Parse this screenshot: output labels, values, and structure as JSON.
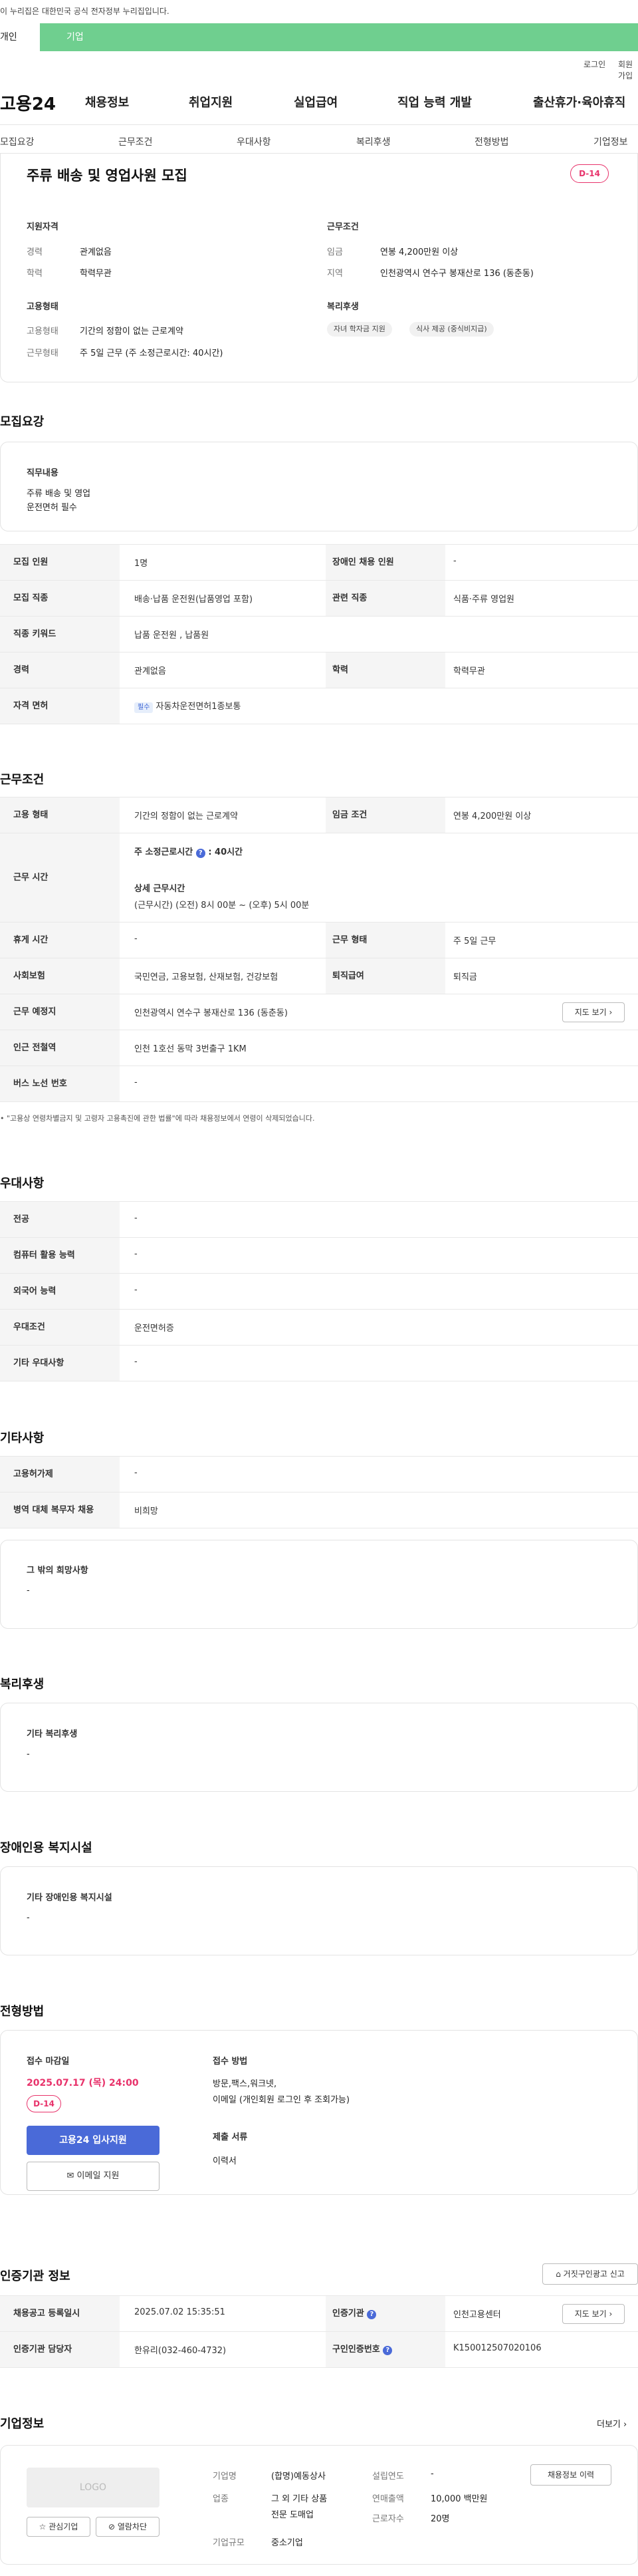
{
  "gov_banner": "이 누리집은 대한민국 공식 전자정부 누리집입니다.",
  "top_tabs": {
    "individual": "개인",
    "company": "기업"
  },
  "util": {
    "login": "로그인",
    "join": "회원가입"
  },
  "logo": "고용24",
  "gnav": [
    "채용정보",
    "취업지원",
    "실업급여",
    "직업 능력 개발",
    "출산휴가·육아휴직"
  ],
  "subnav": [
    "모집요강",
    "근무조건",
    "우대사항",
    "복리후생",
    "전형방법",
    "기업정보"
  ],
  "summary": {
    "title": "주류 배송 및 영업사원 모집",
    "dday": "D-14",
    "qual_label": "지원자격",
    "career_k": "경력",
    "career_v": "관계없음",
    "edu_k": "학력",
    "edu_v": "학력무관",
    "cond_label": "근무조건",
    "wage_k": "임금",
    "wage_v": "연봉 4,200만원 이상",
    "area_k": "지역",
    "area_v": "인천광역시 연수구 봉재산로 136 (동춘동)",
    "emp_label": "고용형태",
    "emp_k": "고용형태",
    "emp_v": "기간의 정함이 없는 근로계약",
    "work_k": "근무형태",
    "work_v": "주 5일 근무 (주 소정근로시간: 40시간)",
    "welfare_label": "복리후생",
    "chips": [
      "자녀 학자금 지원",
      "식사 제공 (중식비지급)"
    ]
  },
  "recruit": {
    "heading": "모집요강",
    "duty_label": "직무내용",
    "duty_lines": [
      "주류 배송 및 영업",
      "운전면허 필수"
    ],
    "rows": {
      "count_k": "모집 인원",
      "count_v": "1명",
      "disabled_k": "장애인 채용 인원",
      "disabled_v": "-",
      "job_k": "모집 직종",
      "job_v": "배송·납품 운전원(납품영업 포함)",
      "rel_k": "관련 직종",
      "rel_v": "식품·주류 영업원",
      "kw_k": "직종 키워드",
      "kw_v": "납품 운전원 , 납품원",
      "career_k": "경력",
      "career_v": "관계없음",
      "edu_k": "학력",
      "edu_v": "학력무관",
      "lic_k": "자격 면허",
      "lic_badge": "필수",
      "lic_v": "자동차운전면허1종보통"
    }
  },
  "work": {
    "heading": "근무조건",
    "emp_k": "고용 형태",
    "emp_v": "기간의 정함이 없는 근로계약",
    "wage_k": "임금 조건",
    "wage_v": "연봉 4,200만원 이상",
    "time_k": "근무 시간",
    "time_week_label": "주 소정근로시간",
    "time_week_v": ": 40시간",
    "time_detail_label": "상세 근무시간",
    "time_detail_v": "(근무시간) (오전) 8시 00분 ~ (오후) 5시 00분",
    "rest_k": "휴게 시간",
    "rest_v": "-",
    "form_k": "근무 형태",
    "form_v": "주 5일 근무",
    "ins_k": "사회보험",
    "ins_v": "국민연금, 고용보험, 산재보험, 건강보험",
    "ret_k": "퇴직급여",
    "ret_v": "퇴직금",
    "place_k": "근무 예정지",
    "place_v": "인천광역시 연수구 봉재산로 136 (동춘동)",
    "map_btn": "지도 보기",
    "station_k": "인근 전철역",
    "station_v": "인천 1호선 동막 3번출구 1KM",
    "bus_k": "버스 노선 번호",
    "bus_v": "-",
    "note": "\"고용상 연령차별금지 및 고령자 고용촉진에 관한 법률\"에 따라 채용정보에서 연령이 삭제되었습니다."
  },
  "pref": {
    "heading": "우대사항",
    "rows": [
      [
        "전공",
        "-"
      ],
      [
        "컴퓨터 활용 능력",
        "-"
      ],
      [
        "외국어 능력",
        "-"
      ],
      [
        "우대조건",
        "운전면허증"
      ],
      [
        "기타 우대사항",
        "-"
      ]
    ]
  },
  "etc": {
    "heading": "기타사항",
    "rows": [
      [
        "고용허가제",
        "-"
      ],
      [
        "병역 대체 복무자 채용",
        "비희망"
      ]
    ],
    "box_label": "그 밖의 희망사항",
    "box_v": "-"
  },
  "welfare": {
    "heading": "복리후생",
    "box_label": "기타 복리후생",
    "box_v": "-"
  },
  "facility": {
    "heading": "장애인용 복지시설",
    "box_label": "기타 장애인용 복지시설",
    "box_v": "-"
  },
  "selection": {
    "heading": "전형방법",
    "deadline_label": "접수 마감일",
    "deadline_v": "2025.07.17 (목) 24:00",
    "dday": "D-14",
    "apply_btn": "고용24 입사지원",
    "email_btn": "이메일 지원",
    "method_label": "접수 방법",
    "method_lines": [
      "방문,팩스,워크넷,",
      "이메일 (개인회원 로그인 후 조회가능)"
    ],
    "docs_label": "제출 서류",
    "docs_v": "이력서"
  },
  "agency": {
    "heading": "인증기관 정보",
    "report_btn": "거짓구인광고 신고",
    "reg_k": "채용공고 등록일시",
    "reg_v": "2025.07.02 15:35:51",
    "org_k": "인증기관",
    "org_v": "인천고용센터",
    "map_btn": "지도 보기",
    "mgr_k": "인증기관 담당자",
    "mgr_v": "한유리(032-460-4732)",
    "no_k": "구인인증번호",
    "no_v": "K150012507020106"
  },
  "company": {
    "heading": "기업정보",
    "more": "더보기",
    "logo_text": "LOGO",
    "fav_btn": "관심기업",
    "block_btn": "열람차단",
    "name_k": "기업명",
    "name_v": "(합명)예동상사",
    "found_k": "설립연도",
    "found_v": "-",
    "hist_btn": "채용정보 이력",
    "ind_k": "업종",
    "ind_lines": [
      "그 외 기타 상품",
      "전문 도매업"
    ],
    "sales_k": "연매출액",
    "sales_v": "10,000 백만원",
    "emp_k": "근로자수",
    "emp_v": "20명",
    "size_k": "기업규모",
    "size_v": "중소기업"
  },
  "colors": {
    "green": "#6fcf8f",
    "accent": "#4a6ad8",
    "dday": "#e8336b"
  }
}
